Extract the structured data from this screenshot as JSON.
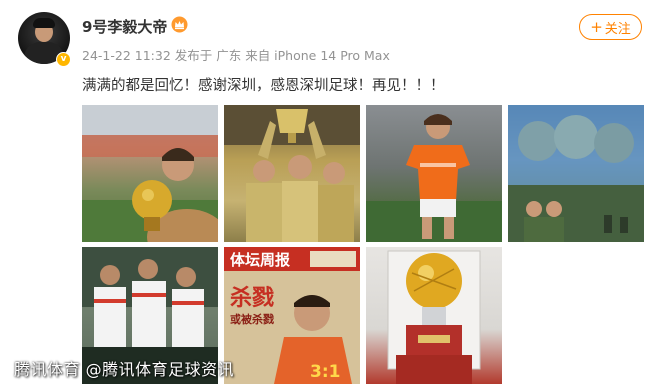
{
  "post": {
    "username": "9号李毅大帝",
    "meta": "24-1-22 11:32 发布于 广东 来自 iPhone 14 Pro Max",
    "follow_label": "关注",
    "content": "满满的都是回忆！感谢深圳，感恩深圳足球！再见！！！"
  },
  "photos": [
    {
      "name": "golden-ball-award-photo"
    },
    {
      "name": "trophy-celebration-photo"
    },
    {
      "name": "orange-jersey-player-photo"
    },
    {
      "name": "movie-poster-soldiers-photo"
    },
    {
      "name": "national-team-players-photo"
    },
    {
      "name": "sports-newspaper-photo"
    },
    {
      "name": "golden-ball-trophy-photo"
    }
  ],
  "newspaper": {
    "masthead": "体坛周报",
    "headline": "杀戮",
    "subline": "或被杀戮",
    "score": "3:1"
  },
  "watermark": "腾讯体育 @腾讯体育足球资讯",
  "colors": {
    "accent": "#ff8200",
    "verified": "#ffb700",
    "text": "#333333",
    "meta": "#939393"
  }
}
